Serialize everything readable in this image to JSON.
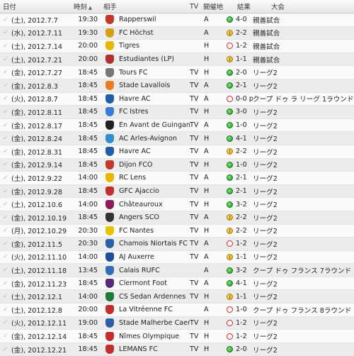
{
  "headers": {
    "date": "日付",
    "time": "時刻",
    "opponent": "相手",
    "tv": "TV",
    "venue": "開催地",
    "result": "結果",
    "competition": "大会",
    "sort_glyph": "▲"
  },
  "icons": {
    "row_check": "✓"
  },
  "matches": [
    {
      "date": "(土), 2012.7.7",
      "time": "19:30",
      "opponent": "Rapperswil",
      "tv": "",
      "venue": "A",
      "result": "win",
      "score": "4-0",
      "competition": "親善試合",
      "crest_color": "#c0392b"
    },
    {
      "date": "(水), 2012.7.11",
      "time": "19:30",
      "opponent": "FC Höchst",
      "tv": "",
      "venue": "A",
      "result": "draw",
      "score": "2-2",
      "competition": "親善試合",
      "crest_color": "#d4a017"
    },
    {
      "date": "(土), 2012.7.14",
      "time": "20:00",
      "opponent": "Tigres",
      "tv": "",
      "venue": "H",
      "result": "loss",
      "score": "1-2",
      "competition": "親善試合",
      "crest_color": "#e6b800"
    },
    {
      "date": "(土), 2012.7.21",
      "time": "20:00",
      "opponent": "Estudiantes (LP)",
      "tv": "",
      "venue": "H",
      "result": "draw",
      "score": "1-1",
      "competition": "親善試合",
      "crest_color": "#b03030"
    },
    {
      "date": "(金), 2012.7.27",
      "time": "18:45",
      "opponent": "Tours FC",
      "tv": "TV",
      "venue": "H",
      "result": "win",
      "score": "2-0",
      "competition": "リーグ2",
      "crest_color": "#777777"
    },
    {
      "date": "(金), 2012.8.3",
      "time": "18:45",
      "opponent": "Stade Lavallois",
      "tv": "TV",
      "venue": "A",
      "result": "win",
      "score": "2-1",
      "competition": "リーグ2",
      "crest_color": "#e67e22"
    },
    {
      "date": "(火), 2012.8.7",
      "time": "18:45",
      "opponent": "Havre AC",
      "tv": "TV",
      "venue": "A",
      "result": "loss",
      "score": "0-0 p",
      "competition": "クープ ドゥ ラ リーグ 1ラウンド",
      "crest_color": "#1f5fa8"
    },
    {
      "date": "(金), 2012.8.11",
      "time": "18:45",
      "opponent": "FC Istres",
      "tv": "TV",
      "venue": "H",
      "result": "win",
      "score": "3-0",
      "competition": "リーグ2",
      "crest_color": "#3a7bd5"
    },
    {
      "date": "(金), 2012.8.17",
      "time": "18:45",
      "opponent": "En Avant de Guingamp",
      "tv": "TV",
      "venue": "A",
      "result": "win",
      "score": "1-0",
      "competition": "リーグ2",
      "crest_color": "#222222"
    },
    {
      "date": "(金), 2012.8.24",
      "time": "18:45",
      "opponent": "AC Arles-Avignon",
      "tv": "TV",
      "venue": "H",
      "result": "win",
      "score": "4-1",
      "competition": "リーグ2",
      "crest_color": "#2d8fd0"
    },
    {
      "date": "(金), 2012.8.31",
      "time": "18:45",
      "opponent": "Havre AC",
      "tv": "TV",
      "venue": "A",
      "result": "draw",
      "score": "2-2",
      "competition": "リーグ2",
      "crest_color": "#1f5fa8"
    },
    {
      "date": "(金), 2012.9.14",
      "time": "18:45",
      "opponent": "Dijon FCO",
      "tv": "TV",
      "venue": "H",
      "result": "win",
      "score": "1-0",
      "competition": "リーグ2",
      "crest_color": "#c0392b"
    },
    {
      "date": "(土), 2012.9.22",
      "time": "14:00",
      "opponent": "RC Lens",
      "tv": "TV",
      "venue": "A",
      "result": "win",
      "score": "2-1",
      "competition": "リーグ2",
      "crest_color": "#e8b400"
    },
    {
      "date": "(金), 2012.9.28",
      "time": "18:45",
      "opponent": "GFC Ajaccio",
      "tv": "TV",
      "venue": "H",
      "result": "win",
      "score": "2-1",
      "competition": "リーグ2",
      "crest_color": "#c03030"
    },
    {
      "date": "(土), 2012.10.6",
      "time": "14:00",
      "opponent": "Châteauroux",
      "tv": "TV",
      "venue": "H",
      "result": "win",
      "score": "3-2",
      "competition": "リーグ2",
      "crest_color": "#8e1c5c"
    },
    {
      "date": "(金), 2012.10.19",
      "time": "18:45",
      "opponent": "Angers SCO",
      "tv": "TV",
      "venue": "A",
      "result": "draw",
      "score": "2-2",
      "competition": "リーグ2",
      "crest_color": "#333333"
    },
    {
      "date": "(月), 2012.10.29",
      "time": "20:30",
      "opponent": "FC Nantes",
      "tv": "TV",
      "venue": "H",
      "result": "draw",
      "score": "2-2",
      "competition": "リーグ2",
      "crest_color": "#e6c200"
    },
    {
      "date": "(金), 2012.11.5",
      "time": "20:30",
      "opponent": "Chamois Niortais FC",
      "tv": "TV",
      "venue": "A",
      "result": "loss",
      "score": "1-2",
      "competition": "リーグ2",
      "crest_color": "#2a5fa8"
    },
    {
      "date": "(火), 2012.11.10",
      "time": "14:00",
      "opponent": "AJ Auxerre",
      "tv": "TV",
      "venue": "A",
      "result": "draw",
      "score": "1-1",
      "competition": "リーグ2",
      "crest_color": "#1f4f9a"
    },
    {
      "date": "(土), 2012.11.18",
      "time": "13:45",
      "opponent": "Calais RUFC",
      "tv": "",
      "venue": "A",
      "result": "win",
      "score": "3-2",
      "competition": "クープ ドゥ フランス 7ラウンド",
      "crest_color": "#2f6fb5"
    },
    {
      "date": "(金), 2012.11.23",
      "time": "18:45",
      "opponent": "Clermont Foot",
      "tv": "TV",
      "venue": "A",
      "result": "win",
      "score": "4-1",
      "competition": "リーグ2",
      "crest_color": "#5a2a7a"
    },
    {
      "date": "(土), 2012.12.1",
      "time": "14:00",
      "opponent": "CS Sedan Ardennes",
      "tv": "TV",
      "venue": "H",
      "result": "draw",
      "score": "1-1",
      "competition": "リーグ2",
      "crest_color": "#1f7a3a"
    },
    {
      "date": "(土), 2012.12.8",
      "time": "20:00",
      "opponent": "La Vitréenne FC",
      "tv": "",
      "venue": "A",
      "result": "loss",
      "score": "1-0",
      "competition": "クープ ドゥ フランス 8ラウンド",
      "crest_color": "#c03030"
    },
    {
      "date": "(火), 2012.12.11",
      "time": "19:00",
      "opponent": "Stade Malherbe Caen",
      "tv": "TV",
      "venue": "H",
      "result": "loss",
      "score": "1-2",
      "competition": "リーグ2",
      "crest_color": "#2a5fa8"
    },
    {
      "date": "(金), 2012.12.14",
      "time": "18:45",
      "opponent": "Nîmes Olympique",
      "tv": "TV",
      "venue": "H",
      "result": "loss",
      "score": "1-2",
      "competition": "リーグ2",
      "crest_color": "#c03030"
    },
    {
      "date": "(金), 2012.12.21",
      "time": "18:45",
      "opponent": "LEMANS FC",
      "tv": "TV",
      "venue": "H",
      "result": "win",
      "score": "2-0",
      "competition": "リーグ2",
      "crest_color": "#c03030"
    }
  ]
}
